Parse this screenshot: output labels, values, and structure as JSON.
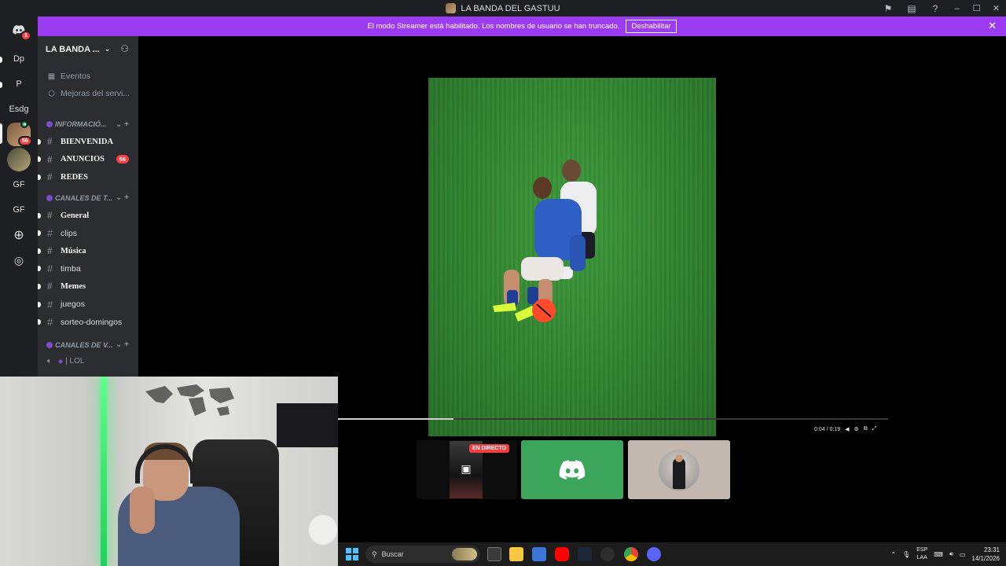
{
  "window": {
    "title": "LA BANDA DEL GASTUU"
  },
  "banner": {
    "message": "El modo Streamer está habilitado. Los nombres de usuario se han truncado.",
    "button": "Deshabilitar"
  },
  "rail": {
    "home_badge": "1",
    "servers": [
      {
        "label": "Dp"
      },
      {
        "label": "P"
      },
      {
        "label": "Esdg"
      },
      {
        "label": "",
        "badge": "56"
      },
      {
        "label": ""
      },
      {
        "label": "GF"
      },
      {
        "label": "GF"
      }
    ]
  },
  "sidebar": {
    "server_name": "LA BANDA ...",
    "menu": [
      {
        "label": "Eventos"
      },
      {
        "label": "Mejoras del servi..."
      }
    ],
    "categories": [
      {
        "name": "INFORMACIÓ...",
        "channels": [
          {
            "name": "BIENVENIDA",
            "unread": true
          },
          {
            "name": "ANUNCIOS",
            "unread": true,
            "mentions": "56"
          },
          {
            "name": "REDES",
            "unread": true
          }
        ]
      },
      {
        "name": "CANALES DE T...",
        "channels": [
          {
            "name": "General",
            "unread": true
          },
          {
            "name": "clips",
            "unread": false
          },
          {
            "name": "Música",
            "unread": true
          },
          {
            "name": "timba",
            "unread": false
          },
          {
            "name": "Memes",
            "unread": true
          },
          {
            "name": "juegos",
            "unread": false
          },
          {
            "name": "sorteo-domingos",
            "unread": false
          }
        ]
      },
      {
        "name": "CANALES DE V...",
        "voice": [
          {
            "name": "| LOL"
          }
        ]
      }
    ]
  },
  "player": {
    "time": "0:04 / 0:19",
    "progress": 0.21
  },
  "tiles": {
    "live_badge": "EN DIRECTO"
  },
  "taskbar": {
    "search_placeholder": "Buscar",
    "lang_line1": "ESP",
    "lang_line2": "LAA",
    "time": "23:31",
    "date": "14/1/2026"
  }
}
